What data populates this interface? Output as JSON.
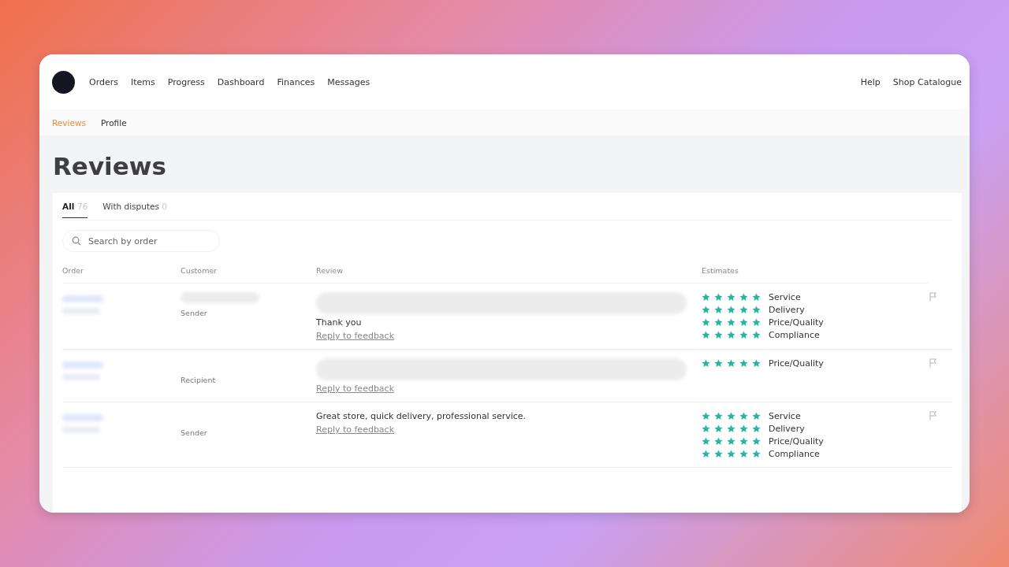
{
  "nav": {
    "links": [
      "Orders",
      "Items",
      "Progress",
      "Dashboard",
      "Finances",
      "Messages"
    ],
    "right_links": [
      "Help",
      "Shop Catalogue"
    ]
  },
  "subnav": [
    {
      "label": "Reviews",
      "selected": true
    },
    {
      "label": "Profile",
      "selected": false
    }
  ],
  "title": "Reviews",
  "tabs": [
    {
      "label": "All",
      "count": "76",
      "selected": true
    },
    {
      "label": "With disputes",
      "count": "0",
      "selected": false
    }
  ],
  "search": {
    "placeholder": "Search by order"
  },
  "columns": [
    "Order",
    "Customer",
    "Review",
    "Estimates"
  ],
  "rows": [
    {
      "name_blurred": true,
      "customer_role": "Sender",
      "review_blurred": true,
      "review": "Thank you",
      "reply_link": "Reply to feedback",
      "estimates": [
        {
          "label": "Service",
          "stars": 5
        },
        {
          "label": "Delivery",
          "stars": 5
        },
        {
          "label": "Price/Quality",
          "stars": 5
        },
        {
          "label": "Compliance",
          "stars": 5
        }
      ]
    },
    {
      "name_blurred": false,
      "customer_role": "Recipient",
      "review_blurred": true,
      "reply_link": "Reply to feedback",
      "estimates": [
        {
          "label": "Price/Quality",
          "stars": 5
        }
      ]
    },
    {
      "name_blurred": false,
      "customer_role": "Sender",
      "review_blurred": false,
      "review": "Great store, quick delivery, professional service.",
      "reply_link": "Reply to feedback",
      "estimates": [
        {
          "label": "Service",
          "stars": 5
        },
        {
          "label": "Delivery",
          "stars": 5
        },
        {
          "label": "Price/Quality",
          "stars": 5
        },
        {
          "label": "Compliance",
          "stars": 5
        }
      ]
    }
  ]
}
